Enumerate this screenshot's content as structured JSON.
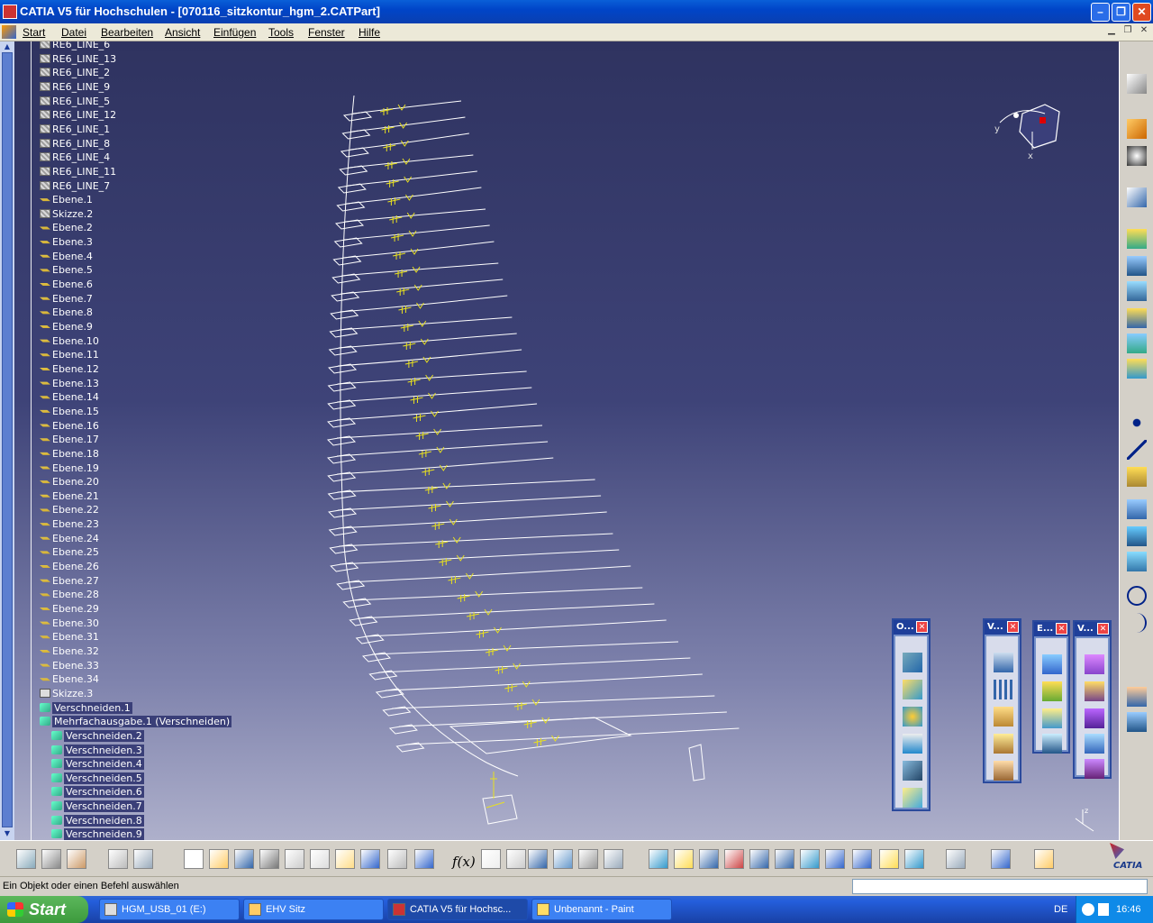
{
  "window": {
    "title": "CATIA V5 für Hochschulen - [070116_sitzkontur_hgm_2.CATPart]",
    "min_label": "–",
    "max_label": "❐",
    "close_label": "✕"
  },
  "menu": {
    "items": [
      "Start",
      "Datei",
      "Bearbeiten",
      "Ansicht",
      "Einfügen",
      "Tools",
      "Fenster",
      "Hilfe"
    ]
  },
  "tree": {
    "lines": [
      "RE6_LINE_13",
      "RE6_LINE_2",
      "RE6_LINE_9",
      "RE6_LINE_5",
      "RE6_LINE_12",
      "RE6_LINE_1",
      "RE6_LINE_8",
      "RE6_LINE_4",
      "RE6_LINE_11",
      "RE6_LINE_7"
    ],
    "top_partial": "RE6_LINE_6",
    "ebene1": "Ebene.1",
    "skizze2": "Skizze.2",
    "ebenen": [
      "Ebene.2",
      "Ebene.3",
      "Ebene.4",
      "Ebene.5",
      "Ebene.6",
      "Ebene.7",
      "Ebene.8",
      "Ebene.9",
      "Ebene.10",
      "Ebene.11",
      "Ebene.12",
      "Ebene.13",
      "Ebene.14",
      "Ebene.15",
      "Ebene.16",
      "Ebene.17",
      "Ebene.18",
      "Ebene.19",
      "Ebene.20",
      "Ebene.21",
      "Ebene.22",
      "Ebene.23",
      "Ebene.24",
      "Ebene.25",
      "Ebene.26",
      "Ebene.27",
      "Ebene.28",
      "Ebene.29",
      "Ebene.30",
      "Ebene.31",
      "Ebene.32",
      "Ebene.33",
      "Ebene.34"
    ],
    "skizze3": "Skizze.3",
    "verschneiden1": "Verschneiden.1",
    "mehrfach": "Mehrfachausgabe.1 (Verschneiden)",
    "verschneiden_children": [
      "Verschneiden.2",
      "Verschneiden.3",
      "Verschneiden.4",
      "Verschneiden.5",
      "Verschneiden.6",
      "Verschneiden.7",
      "Verschneiden.8",
      "Verschneiden.9"
    ]
  },
  "panels": [
    {
      "title": "O..."
    },
    {
      "title": "V..."
    },
    {
      "title": "E..."
    },
    {
      "title": "V..."
    }
  ],
  "compass": {
    "y_label": "y",
    "x_label": "x"
  },
  "axis_mini": {
    "label": "z"
  },
  "status": {
    "text": "Ein Objekt oder einen Befehl auswählen",
    "fx_label": "f(x)"
  },
  "catia_logo": "CATIA",
  "taskbar": {
    "start": "Start",
    "tasks": [
      "HGM_USB_01 (E:)",
      "EHV Sitz",
      "CATIA V5 für Hochsc...",
      "Unbenannt - Paint"
    ],
    "lang": "DE",
    "clock": "16:46"
  }
}
